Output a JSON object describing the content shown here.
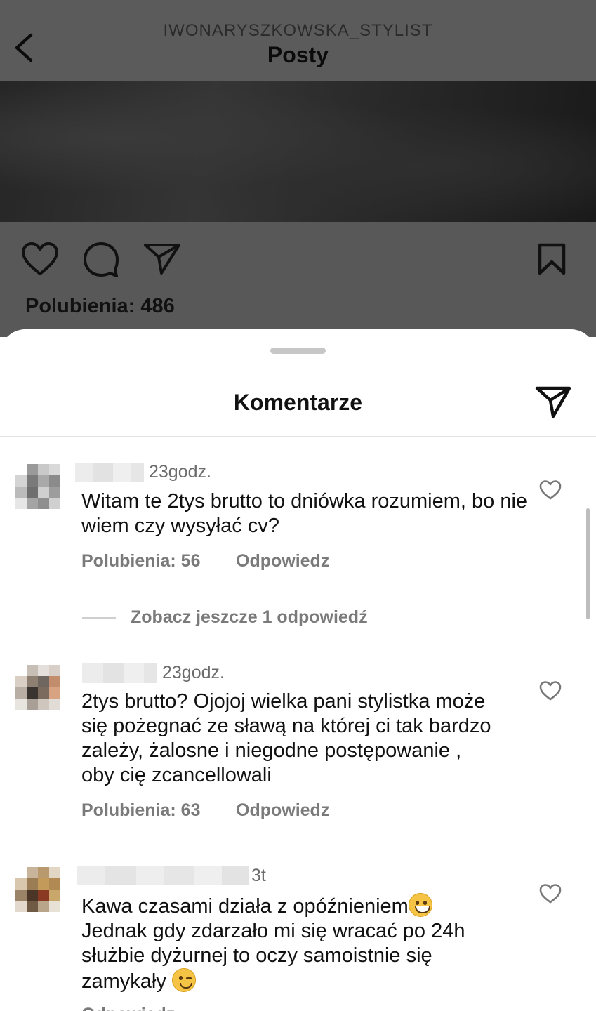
{
  "header": {
    "account": "IWONARYSZKOWSKA_STYLIST",
    "title": "Posty"
  },
  "post": {
    "likes_label": "Polubienia: 486"
  },
  "sheet": {
    "title": "Komentarze"
  },
  "comments": [
    {
      "time": "23godz.",
      "text": "Witam te 2tys brutto to dniówka rozumiem, bo nie wiem czy wysyłać cv?",
      "likes": "Polubienia: 56",
      "reply": "Odpowiedz",
      "more_replies": "Zobacz jeszcze 1 odpowiedź"
    },
    {
      "time": "23godz.",
      "text": "2tys brutto? Ojojoj wielka pani stylistka może się pożegnać ze sławą na której ci tak bardzo zależy, żalosne i niegodne postępowanie , oby cię zcancellowali",
      "likes": "Polubienia: 63",
      "reply": "Odpowiedz"
    },
    {
      "time": "3t",
      "text_part1": "Kawa czasami działa z opóźnieniem",
      "text_part2": "Jednak gdy zdarzało mi się wracać po 24h służbie dyżurnej to oczy samoistnie się zamykały",
      "reply": "Odpowiedz"
    }
  ],
  "icons": {
    "back": "chevron-left-icon",
    "like": "heart-icon",
    "comment": "comment-icon",
    "share": "paper-plane-icon",
    "save": "bookmark-icon",
    "emoji1": "grinning-face-icon",
    "emoji2": "winking-face-icon"
  }
}
